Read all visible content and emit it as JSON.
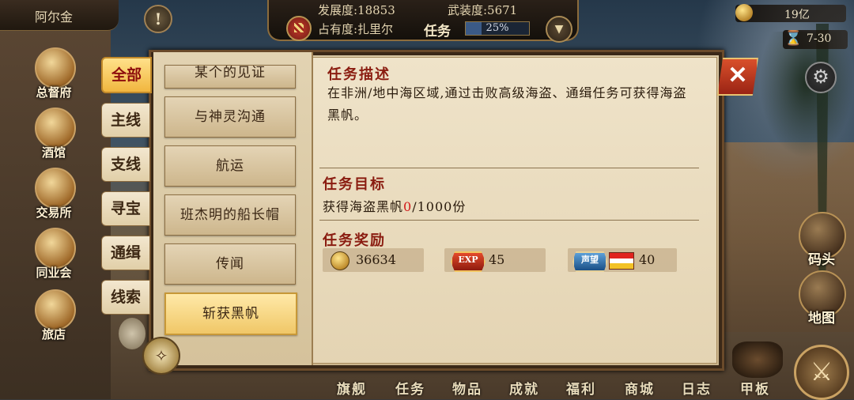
{
  "player": {
    "name": "阿尔金"
  },
  "header": {
    "development_label": "发展度:18853",
    "military_label": "武装度:5671",
    "occupancy_label": "占有度:扎里尔",
    "task_label": "任务",
    "task_progress_text": "25%",
    "task_progress_fraction": 0.25
  },
  "resources": {
    "money": "19亿",
    "date": "7-30"
  },
  "left_nav": [
    {
      "label": "总督府",
      "icon": "crown-icon"
    },
    {
      "label": "酒馆",
      "icon": "tavern-icon"
    },
    {
      "label": "交易所",
      "icon": "scales-icon"
    },
    {
      "label": "同业会",
      "icon": "guild-shield-icon"
    },
    {
      "label": "旅店",
      "icon": "inn-bag-icon"
    }
  ],
  "tabs": [
    {
      "label": "全部",
      "active": true
    },
    {
      "label": "主线",
      "active": false
    },
    {
      "label": "支线",
      "active": false
    },
    {
      "label": "寻宝",
      "active": false
    },
    {
      "label": "通缉",
      "active": false
    },
    {
      "label": "线索",
      "active": false
    }
  ],
  "quest_list": [
    {
      "label": "某个的见证",
      "active": false,
      "partial": true
    },
    {
      "label": "与神灵沟通",
      "active": false
    },
    {
      "label": "航运",
      "active": false
    },
    {
      "label": "班杰明的船长帽",
      "active": false
    },
    {
      "label": "传闻",
      "active": false
    },
    {
      "label": "斩获黑帆",
      "active": true
    }
  ],
  "detail": {
    "desc_title": "任务描述",
    "desc_text": "在非洲/地中海区域,通过击败高级海盗、通缉任务可获得海盗黑帆。",
    "goal_title": "任务目标",
    "goal_prefix": "获得海盗黑帆",
    "goal_current": "0",
    "goal_suffix": "/1000份",
    "reward_title": "任务奖励",
    "rewards": {
      "coins": "36634",
      "exp_badge": "EXP",
      "exp": "45",
      "reputation_badge": "声望",
      "reputation": "40"
    }
  },
  "right_nav": [
    {
      "label": "码头",
      "icon": "dock-icon"
    },
    {
      "label": "地图",
      "icon": "map-scroll-icon"
    }
  ],
  "bottom_nav": [
    "旗舰",
    "任务",
    "物品",
    "成就",
    "福利",
    "商城",
    "日志",
    "甲板"
  ],
  "colors": {
    "accent_red": "#8a1c10",
    "highlight_gold": "#f0c767",
    "goal_red": "#d21a1a"
  }
}
